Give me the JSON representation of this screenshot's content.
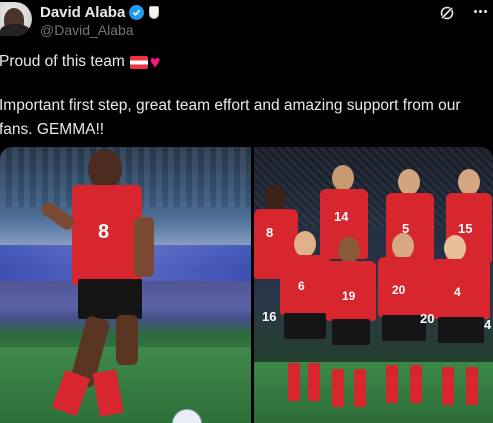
{
  "header": {
    "display_name": "David Alaba",
    "handle": "@David_Alaba"
  },
  "post": {
    "line1": "Proud of this team",
    "body": "Important first step, great team effort and amazing support from our fans. GEMMA!!"
  },
  "media": {
    "left_player_number": "8",
    "team_numbers": [
      "8",
      "14",
      "5",
      "15",
      "6",
      "19",
      "20",
      "4",
      "16",
      "20",
      "4"
    ]
  },
  "colors": {
    "background": "#000000",
    "text": "#e7e9ea",
    "secondary_text": "#71767b",
    "verified_blue": "#1d9bf0",
    "heart": "#f91880",
    "kit_red": "#d7262e"
  },
  "icons": {
    "verified": "verified-badge-icon",
    "affiliate": "club-crest-icon",
    "grok": "grok-icon",
    "more": "more-options-icon",
    "flag": "austria-flag-emoji",
    "heart": "red-heart-emoji"
  }
}
